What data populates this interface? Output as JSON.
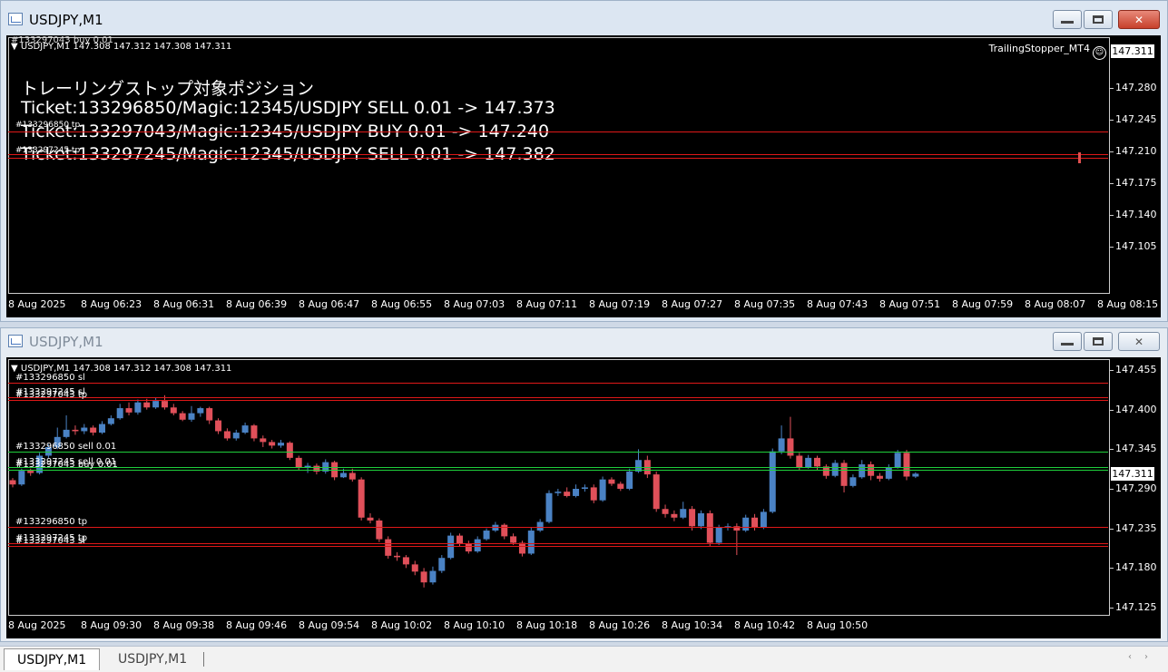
{
  "top": {
    "title": "USDJPY,M1",
    "symbol_line": "USDJPY,M1  147.308 147.312 147.308 147.311",
    "symbol_behind": "#133297043 buy 0.01",
    "ea_name": "TrailingStopper_MT4",
    "overlay_title": "トレーリングストップ対象ポジション",
    "overlay_lines": [
      "Ticket:133296850/Magic:12345/USDJPY SELL 0.01 -> 147.373",
      "Ticket:133297043/Magic:12345/USDJPY BUY 0.01 -> 147.240",
      "Ticket:133297245/Magic:12345/USDJPY SELL 0.01 -> 147.382"
    ],
    "tiny_labels": [
      "#133296850 tp",
      "#133297245 tp"
    ],
    "current_price": "147.311",
    "price_labels": [
      "147.280",
      "147.245",
      "147.210",
      "147.175",
      "147.140",
      "147.105"
    ],
    "time_labels": [
      "8 Aug 2025",
      "8 Aug 06:23",
      "8 Aug 06:31",
      "8 Aug 06:39",
      "8 Aug 06:47",
      "8 Aug 06:55",
      "8 Aug 07:03",
      "8 Aug 07:11",
      "8 Aug 07:19",
      "8 Aug 07:27",
      "8 Aug 07:35",
      "8 Aug 07:43",
      "8 Aug 07:51",
      "8 Aug 07:59",
      "8 Aug 08:07",
      "8 Aug 08:15"
    ],
    "lines": [
      147.24,
      147.217,
      147.214
    ]
  },
  "bottom": {
    "title": "USDJPY,M1",
    "symbol_line": "USDJPY,M1  147.308 147.312 147.308 147.311",
    "current_price": "147.311",
    "price_labels": [
      "147.455",
      "147.400",
      "147.345",
      "147.290",
      "147.235",
      "147.180",
      "147.125"
    ],
    "time_labels": [
      "8 Aug 2025",
      "8 Aug 09:30",
      "8 Aug 09:38",
      "8 Aug 09:46",
      "8 Aug 09:54",
      "8 Aug 10:02",
      "8 Aug 10:10",
      "8 Aug 10:18",
      "8 Aug 10:26",
      "8 Aug 10:34",
      "8 Aug 10:42",
      "8 Aug 10:50"
    ],
    "order_lines": [
      {
        "label": "#133296850 sl",
        "price": 147.437,
        "color": "red"
      },
      {
        "label": "#133297245 sl",
        "price": 147.417,
        "color": "red"
      },
      {
        "label": "#133297043 tp",
        "price": 147.414,
        "color": "red"
      },
      {
        "label": "#133296850 sell 0.01",
        "price": 147.342,
        "color": "green"
      },
      {
        "label": "#133297245 sell 0.01",
        "price": 147.32,
        "color": "green"
      },
      {
        "label": "#133297043 buy 0.01",
        "price": 147.316,
        "color": "green"
      },
      {
        "label": "#133296850 tp",
        "price": 147.237,
        "color": "red"
      },
      {
        "label": "#133297245 tp",
        "price": 147.215,
        "color": "red"
      },
      {
        "label": "#133297043 sl",
        "price": 147.211,
        "color": "red"
      }
    ],
    "colors": {
      "bull": "#4a82c4",
      "bear": "#e0505a",
      "red_line": "#e01818",
      "green_line": "#1fcf3c"
    }
  },
  "tabs": [
    "USDJPY,M1",
    "USDJPY,M1"
  ]
}
